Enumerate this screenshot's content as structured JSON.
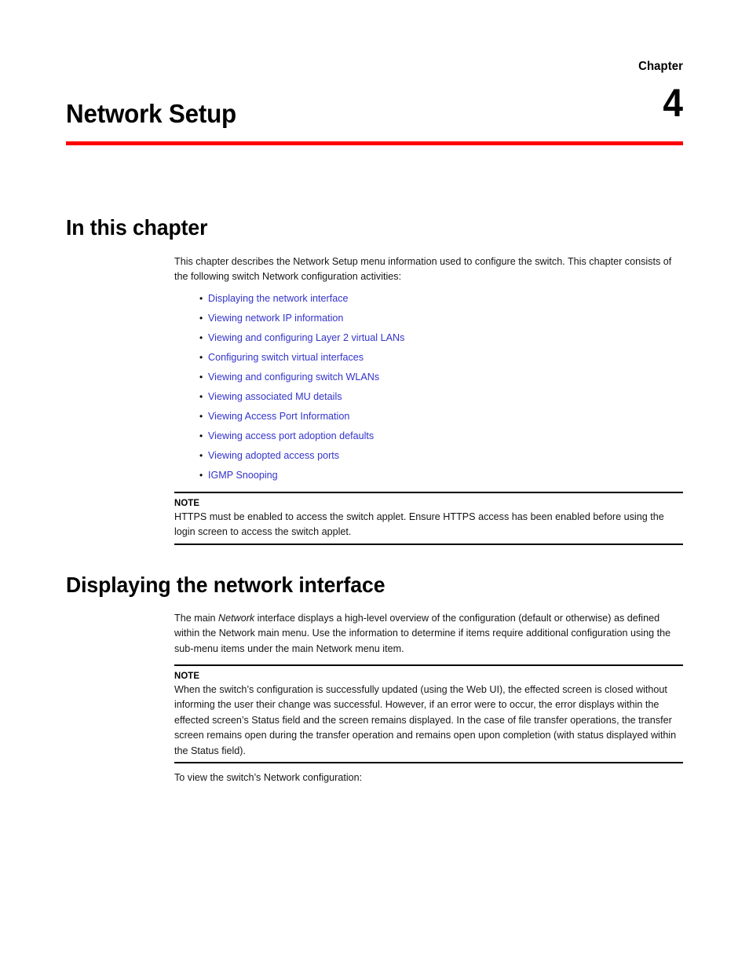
{
  "chapter": {
    "label": "Chapter",
    "number": "4",
    "title": "Network Setup",
    "rule_color": "#ff0000"
  },
  "sections": {
    "in_this_chapter": {
      "heading": "In this chapter",
      "intro": "This chapter describes the Network Setup menu information used to configure the switch. This chapter consists of the following switch Network configuration activities:",
      "links": [
        "Displaying the network interface",
        "Viewing network IP information",
        "Viewing and configuring Layer 2 virtual LANs",
        "Configuring switch virtual interfaces",
        "Viewing and configuring switch WLANs",
        "Viewing associated MU details",
        "Viewing Access Port Information",
        "Viewing access port adoption defaults",
        "Viewing adopted access ports",
        "IGMP Snooping"
      ],
      "link_color": "#3333cc",
      "bullet_glyph": "•"
    },
    "note_https": {
      "label": "NOTE",
      "text": "HTTPS must be enabled to access the switch applet. Ensure HTTPS access has been enabled before using the login screen to access the switch applet."
    },
    "displaying_network_interface": {
      "heading": "Displaying the network interface",
      "paragraph_part1": "The main ",
      "paragraph_italic": "Network",
      "paragraph_part2": " interface displays a high-level overview of the configuration (default or otherwise) as defined within the Network main menu. Use the information to determine if items require additional configuration using the sub-menu items under the main Network menu item.",
      "closing": "To view the switch’s Network configuration:"
    },
    "note_webui": {
      "label": "NOTE",
      "text": "When the switch’s configuration is successfully updated (using the Web UI), the effected screen is closed without informing the user their change was successful. However, if an error were to occur, the error displays within the effected screen’s Status field and the screen remains displayed. In the case of file transfer operations, the transfer screen remains open during the transfer operation and remains open upon completion (with status displayed within the Status field)."
    }
  }
}
